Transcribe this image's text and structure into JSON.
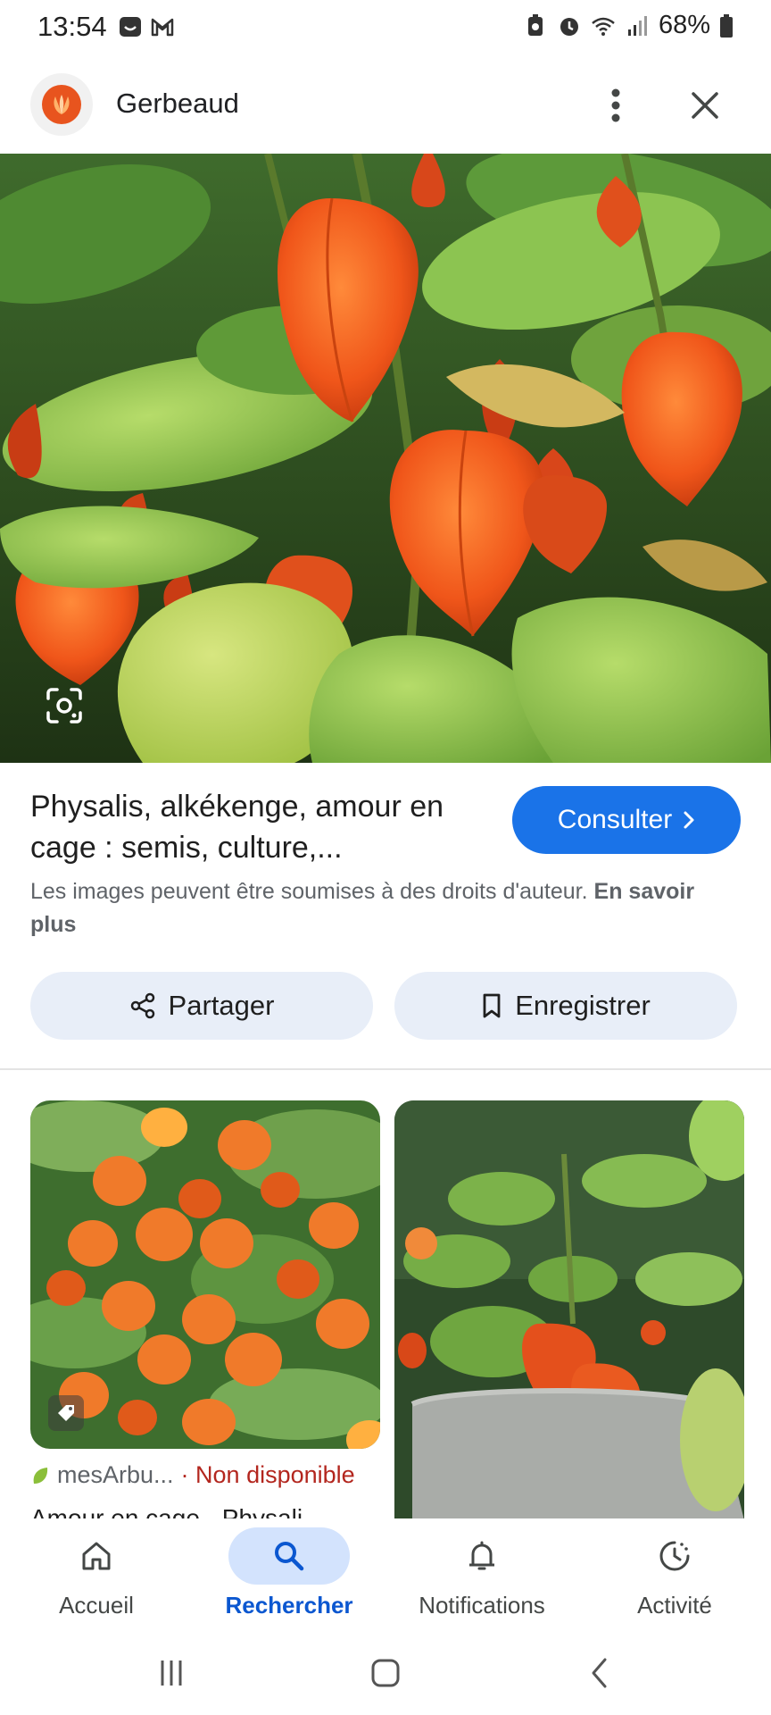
{
  "status_bar": {
    "time": "13:54",
    "battery": "68%",
    "left_icons": [
      "screen-share-icon",
      "gmail-icon"
    ],
    "right_icons": [
      "battery-saver-icon",
      "alarm-icon",
      "wifi-icon",
      "signal-icon",
      "battery-icon"
    ]
  },
  "header": {
    "site_name": "Gerbeaud",
    "logo_color": "#e8541e"
  },
  "hero": {
    "lens_icon": "lens-icon"
  },
  "result": {
    "title": "Physalis, alkékenge, amour en cage : semis, culture,...",
    "consult_label": "Consulter",
    "copyright_text": "Les images peuvent être soumises à des droits d'auteur.",
    "learn_more": "En savoir plus"
  },
  "actions": {
    "share_label": "Partager",
    "save_label": "Enregistrer"
  },
  "related": {
    "card1": {
      "source": "mesArbu...",
      "availability": "· Non disponible",
      "title": "Amour en cage - Physali"
    }
  },
  "bottom_nav": {
    "items": [
      {
        "label": "Accueil",
        "icon": "home-icon"
      },
      {
        "label": "Rechercher",
        "icon": "search-icon"
      },
      {
        "label": "Notifications",
        "icon": "bell-icon"
      },
      {
        "label": "Activité",
        "icon": "activity-icon"
      }
    ],
    "active": "Rechercher"
  },
  "colors": {
    "accent": "#1a73e8",
    "active_nav": "#0b57d0",
    "action_bg": "#e8eef8",
    "unavailable": "#b3261e"
  }
}
